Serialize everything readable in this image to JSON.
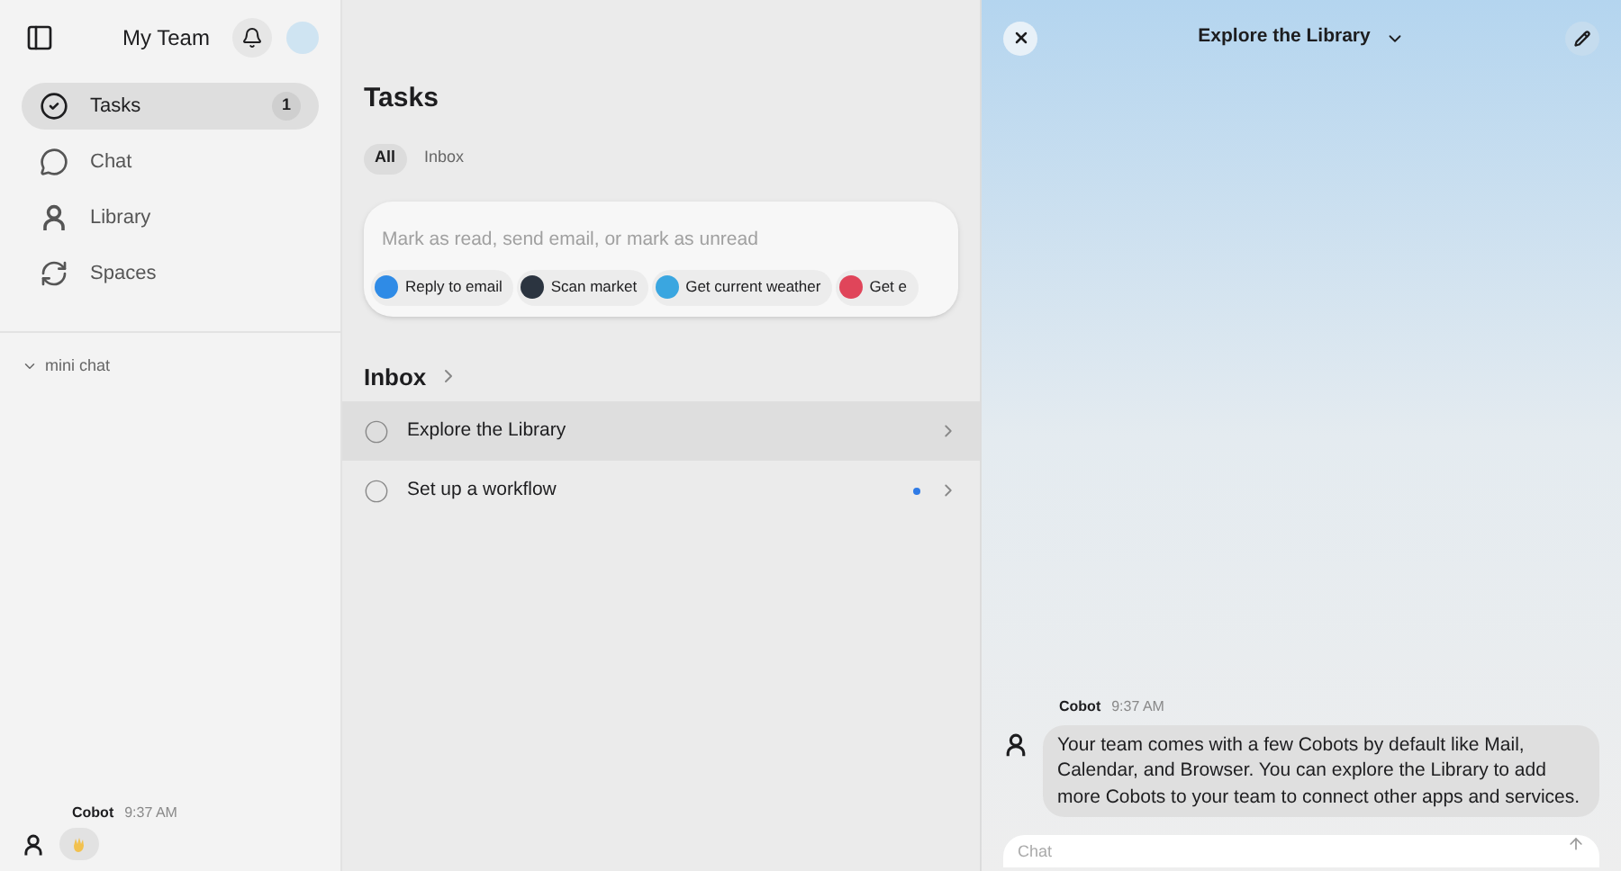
{
  "sidebar": {
    "title": "My Team",
    "nav": [
      {
        "label": "Tasks",
        "kind": "check",
        "selected": true,
        "badge": "1"
      },
      {
        "label": "Chat",
        "kind": "chat",
        "selected": false
      },
      {
        "label": "Library",
        "kind": "person",
        "selected": false
      },
      {
        "label": "Spaces",
        "kind": "spaces",
        "selected": false
      }
    ],
    "mini_chat": {
      "label": "mini chat",
      "expanded": true,
      "sender": "Cobot",
      "time": "9:37 AM"
    }
  },
  "tasks": {
    "title": "Tasks",
    "tabs": [
      {
        "label": "All",
        "selected": true
      },
      {
        "label": "Inbox",
        "selected": false
      }
    ],
    "command": {
      "placeholder": "Mark as read, send email, or mark as unread",
      "chips": [
        {
          "label": "Reply to email",
          "color": "#2f8be6"
        },
        {
          "label": "Scan market",
          "color": "#2b3440"
        },
        {
          "label": "Get current weather",
          "color": "#3aa6e0"
        },
        {
          "label": "Get e",
          "color": "#e0455a"
        }
      ]
    },
    "inbox": {
      "title": "Inbox",
      "items": [
        {
          "label": "Explore the Library",
          "selected": true,
          "unread": false
        },
        {
          "label": "Set up a workflow",
          "selected": false,
          "unread": true
        }
      ]
    }
  },
  "detail": {
    "title": "Explore the Library",
    "message": {
      "sender": "Cobot",
      "time": "9:37 AM",
      "text": "Your team comes with a few Cobots by default like Mail, Calendar, and Browser. You can explore the Library to add more Cobots to your team to connect other apps and services."
    },
    "input": {
      "placeholder": "Chat"
    }
  }
}
